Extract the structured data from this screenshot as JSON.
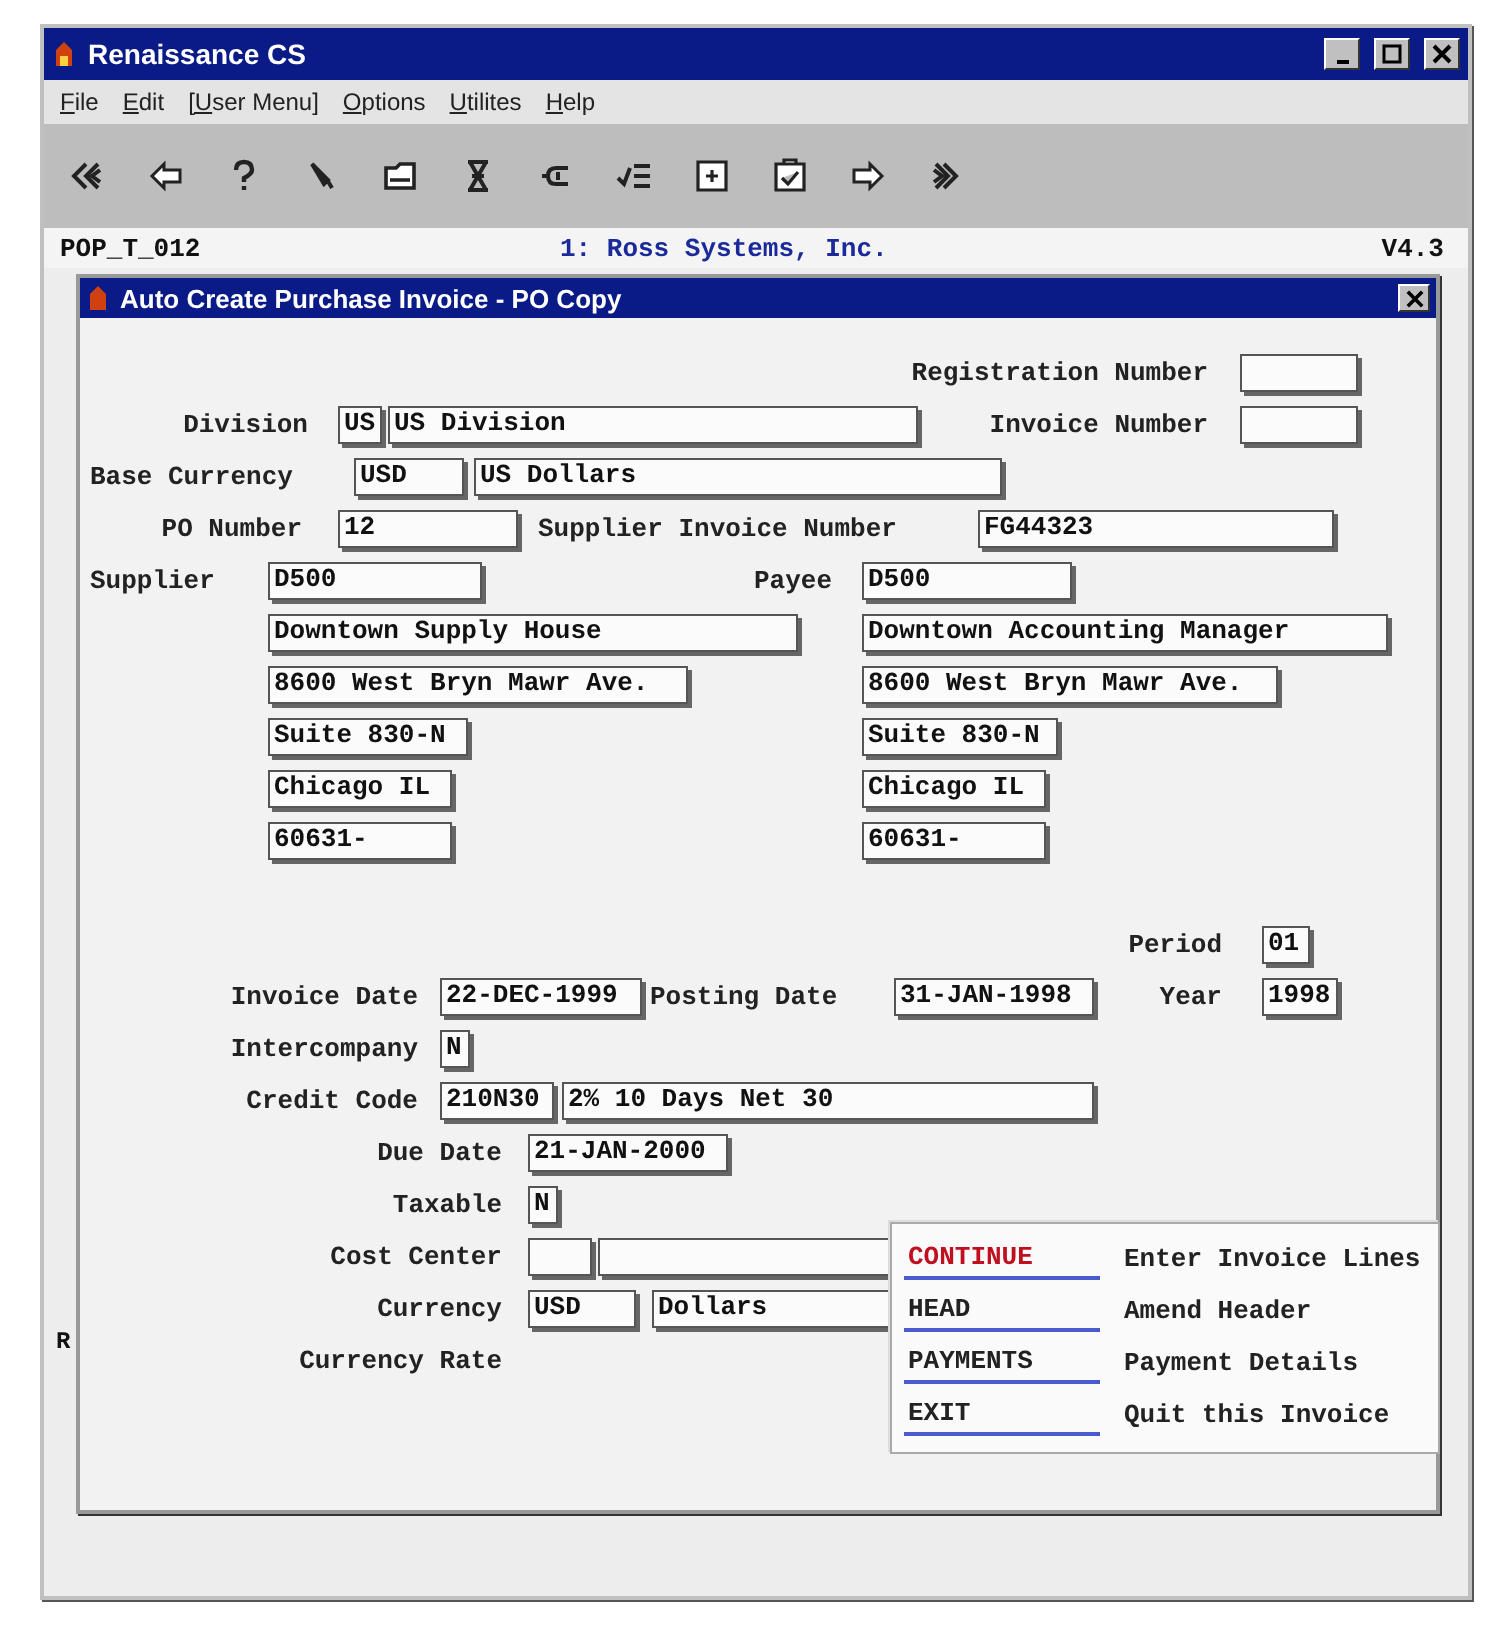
{
  "window": {
    "title": "Renaissance CS"
  },
  "menu": [
    "File",
    "Edit",
    "[User Menu]",
    "Options",
    "Utilites",
    "Help"
  ],
  "status_line": {
    "program": "POP_T_012",
    "company": "1: Ross Systems, Inc.",
    "version": "V4.3"
  },
  "margin_text": "R",
  "dialog": {
    "title": "Auto Create Purchase Invoice - PO Copy",
    "form": [
      {
        "kind": "label",
        "text": "Registration Number"
      },
      {
        "kind": "field"
      },
      {
        "kind": "label",
        "text": "Division"
      },
      {
        "kind": "field",
        "value": "US"
      },
      {
        "kind": "field",
        "value": "US Division"
      },
      {
        "kind": "label",
        "text": "Invoice Number"
      },
      {
        "kind": "field"
      },
      {
        "kind": "label",
        "text": "Base Currency"
      },
      {
        "kind": "field",
        "value": "USD"
      },
      {
        "kind": "field",
        "value": "US Dollars"
      },
      {
        "kind": "label",
        "text": "PO Number"
      },
      {
        "kind": "field",
        "value": "12"
      },
      {
        "kind": "label",
        "text": "Supplier Invoice Number"
      },
      {
        "kind": "field",
        "value": "FG44323"
      },
      {
        "kind": "label",
        "text": "Supplier"
      },
      {
        "kind": "field",
        "value": "D500"
      },
      {
        "kind": "label",
        "text": "Payee"
      },
      {
        "kind": "field",
        "value": "D500"
      },
      {
        "kind": "field",
        "value": "Downtown Supply House"
      },
      {
        "kind": "field",
        "value": "Downtown Accounting Manager"
      },
      {
        "kind": "field",
        "value": "8600 West Bryn Mawr Ave."
      },
      {
        "kind": "field",
        "value": "8600 West Bryn Mawr Ave."
      },
      {
        "kind": "field",
        "value": "Suite 830-N"
      },
      {
        "kind": "field",
        "value": "Suite 830-N"
      },
      {
        "kind": "field",
        "value": "Chicago IL"
      },
      {
        "kind": "field",
        "value": "Chicago IL"
      },
      {
        "kind": "field",
        "value": "60631-"
      },
      {
        "kind": "field",
        "value": "60631-"
      },
      {
        "kind": "label",
        "text": "Period"
      },
      {
        "kind": "field",
        "value": "01"
      },
      {
        "kind": "label",
        "text": "Invoice Date"
      },
      {
        "kind": "field",
        "value": "22-DEC-1999"
      },
      {
        "kind": "label",
        "text": "Posting Date"
      },
      {
        "kind": "field",
        "value": "31-JAN-1998"
      },
      {
        "kind": "label",
        "text": "Year"
      },
      {
        "kind": "field",
        "value": "1998"
      },
      {
        "kind": "label",
        "text": "Intercompany"
      },
      {
        "kind": "field",
        "value": "N"
      },
      {
        "kind": "label",
        "text": "Credit Code"
      },
      {
        "kind": "field",
        "value": "210N30"
      },
      {
        "kind": "field",
        "value": "2% 10 Days Net 30"
      },
      {
        "kind": "label",
        "text": "Due Date"
      },
      {
        "kind": "field",
        "value": "21-JAN-2000"
      },
      {
        "kind": "label",
        "text": "Taxable"
      },
      {
        "kind": "field",
        "value": "N"
      },
      {
        "kind": "label",
        "text": "Cost Center"
      },
      {
        "kind": "field"
      },
      {
        "kind": "field"
      },
      {
        "kind": "label",
        "text": "Currency"
      },
      {
        "kind": "field",
        "value": "USD"
      },
      {
        "kind": "field",
        "value": "Dollars"
      },
      {
        "kind": "label",
        "text": "Currency Rate"
      }
    ],
    "actions": [
      {
        "command": "CONTINUE",
        "description": "Enter Invoice Lines",
        "selected": true
      },
      {
        "command": "HEAD",
        "description": "Amend Header",
        "selected": false
      },
      {
        "command": "PAYMENTS",
        "description": "Payment Details",
        "selected": false
      },
      {
        "command": "EXIT",
        "description": "Quit this Invoice",
        "selected": false
      }
    ]
  }
}
